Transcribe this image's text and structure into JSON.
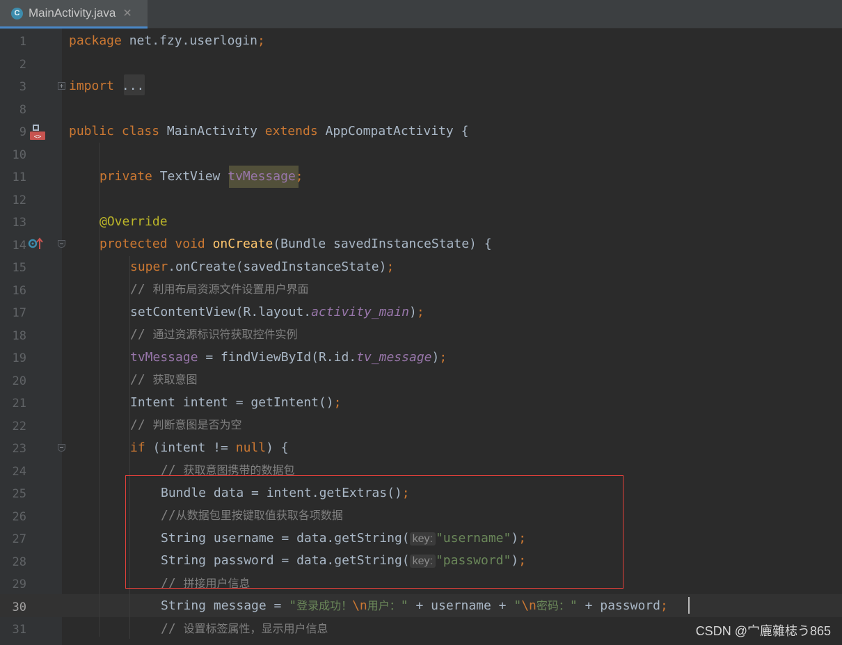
{
  "tab": {
    "icon_letter": "C",
    "title": "MainActivity.java",
    "close_glyph": "✕"
  },
  "gutter": {
    "line_numbers": [
      "1",
      "2",
      "3",
      "8",
      "9",
      "10",
      "11",
      "12",
      "13",
      "14",
      "15",
      "16",
      "17",
      "18",
      "19",
      "20",
      "21",
      "22",
      "23",
      "24",
      "25",
      "26",
      "27",
      "28",
      "29",
      "30",
      "31"
    ],
    "current_line": "30",
    "icons": [
      "class-override-icon",
      "override-method-icon"
    ]
  },
  "code": {
    "l1": [
      "package",
      "net.fzy.userlogin",
      ";"
    ],
    "l3": [
      "import",
      "..."
    ],
    "l9": [
      "public",
      "class",
      "MainActivity",
      "extends",
      "AppCompatActivity {"
    ],
    "l11": [
      "private",
      "TextView",
      "tvMessage",
      ";"
    ],
    "l13": [
      "@Override"
    ],
    "l14": [
      "protected",
      "void",
      "onCreate",
      "(Bundle savedInstanceState) {"
    ],
    "l15": [
      "super",
      ".onCreate(savedInstanceState)",
      ";"
    ],
    "l16": [
      "// ",
      "利用布局资源文件设置用户界面"
    ],
    "l17": [
      "setContentView(R.layout.",
      "activity_main",
      ")",
      ";"
    ],
    "l18": [
      "// ",
      "通过资源标识符获取控件实例"
    ],
    "l19": [
      "tvMessage",
      " = findViewById(R.id.",
      "tv_message",
      ")",
      ";"
    ],
    "l20": [
      "// ",
      "获取意图"
    ],
    "l21": [
      "Intent intent = getIntent()",
      ";"
    ],
    "l22": [
      "// ",
      "判断意图是否为空"
    ],
    "l23": [
      "if",
      " (intent != ",
      "null",
      ") {"
    ],
    "l24": [
      "// ",
      "获取意图携带的数据包"
    ],
    "l25": [
      "Bundle data = intent.getExtras()",
      ";"
    ],
    "l26": [
      "//",
      "从数据包里按键取值获取各项数据"
    ],
    "l27": [
      "String username = data.getString(",
      "key:",
      "\"username\"",
      ")",
      ";"
    ],
    "l28": [
      "String password = data.getString(",
      "key:",
      "\"password\"",
      ")",
      ";"
    ],
    "l29": [
      "// ",
      "拼接用户信息"
    ],
    "l30": [
      "String message = ",
      "\"",
      "登录成功！",
      "\\n",
      "用户：",
      "\"",
      " + username + ",
      "\"",
      "\\n",
      "密码：",
      "\"",
      " + password",
      ";"
    ],
    "l31": [
      "// ",
      "设置标签属性，显示用户信息"
    ]
  },
  "watermark": "CSDN @宀廘雜梽う865",
  "colors": {
    "background": "#2b2b2b",
    "keyword": "#cc7832",
    "string": "#6a8759",
    "comment": "#808080",
    "method": "#ffc66d",
    "field": "#9876aa",
    "annotation": "#bbb529",
    "highlight_box": "#e0403a"
  }
}
